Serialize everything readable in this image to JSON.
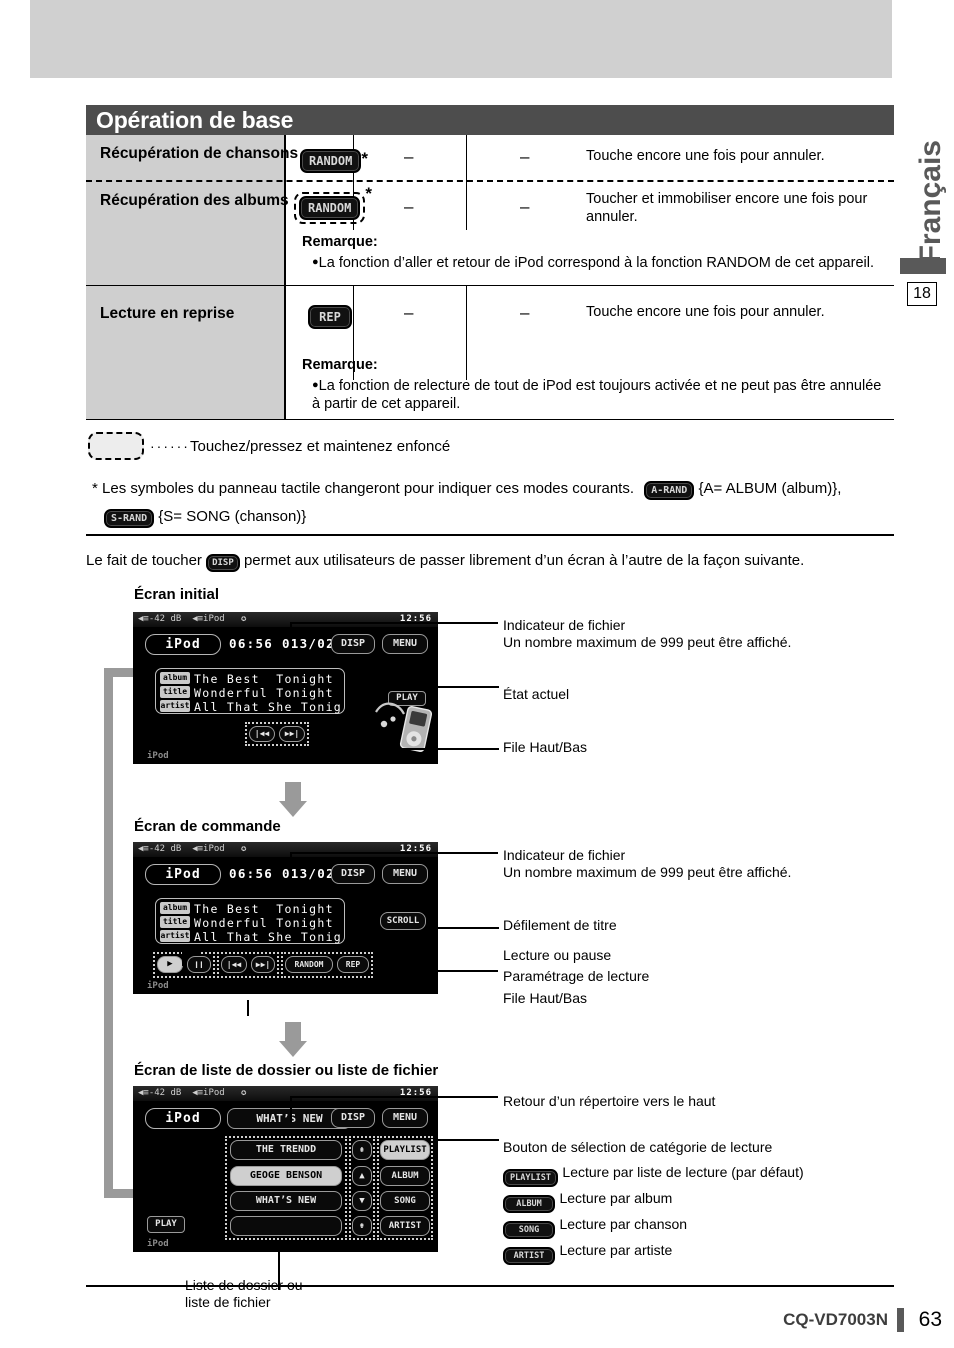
{
  "page": {
    "title": "Opération de base",
    "language_tab": "Français",
    "section_number": "18",
    "model": "CQ-VD7003N",
    "page_number": "63"
  },
  "table": {
    "rows": [
      {
        "label": "Récupération de chansons",
        "key": "RANDOM",
        "key_style": "solid",
        "star": "*",
        "col2": "–",
        "col3": "–",
        "description": "Touche encore une fois pour annuler.",
        "note_title": "",
        "note_body": ""
      },
      {
        "label": "Récupération des albums",
        "key": "RANDOM",
        "key_style": "dashed",
        "star": "*",
        "col2": "–",
        "col3": "–",
        "description": "Toucher et immobiliser encore une fois pour annuler.",
        "note_title": "Remarque:",
        "note_body": "La fonction d’aller et retour de iPod correspond à la fonction RANDOM de cet appareil."
      },
      {
        "label": "Lecture en reprise",
        "key": "REP",
        "key_style": "solid",
        "star": "",
        "col2": "–",
        "col3": "–",
        "description": "Touche encore une fois pour annuler.",
        "note_title": "Remarque:",
        "note_body": "La fonction de relecture de tout de iPod est toujours activée et ne peut pas être annulée à partir de cet appareil."
      }
    ]
  },
  "legend": {
    "dots": "······",
    "text": "Touchez/pressez et maintenez enfoncé"
  },
  "footnote": {
    "star": "*",
    "line1": "Les symboles du panneau tactile changeront pour indiquer ces modes courants.",
    "badge_a": "A-RAND",
    "badge_a_text": "{A= ALBUM (album)},",
    "badge_s": "S-RAND",
    "badge_s_text": "{S= SONG (chanson)}"
  },
  "intro": {
    "before": "Le fait de toucher",
    "badge": "DISP",
    "after": "permet aux utilisateurs de passer librement d’un écran à l’autre de la façon suivante."
  },
  "screens": [
    {
      "section_title": "Écran initial",
      "status_volume": "-42 dB",
      "status_source": "iPod",
      "status_time": "12:56",
      "source_tag": "iPod",
      "track_info": "06:56 013/022",
      "btn_disp": "DISP",
      "btn_menu": "MENU",
      "info": [
        {
          "tag": "album",
          "value": "The Best  Tonight"
        },
        {
          "tag": "title",
          "value": "Wonderful Tonight"
        },
        {
          "tag": "artist",
          "value": "All That She Tonig"
        }
      ],
      "state_badge": "PLAY",
      "transport": [
        "|◀◀",
        "▶▶|"
      ],
      "foot": "iPod",
      "annotations": [
        {
          "text": "Indicateur de fichier\nUn nombre maximum de 999 peut être affiché."
        },
        {
          "text": "État actuel"
        },
        {
          "text": "File Haut/Bas"
        }
      ]
    },
    {
      "section_title": "Écran de commande",
      "status_volume": "-42 dB",
      "status_source": "iPod",
      "status_time": "12:56",
      "source_tag": "iPod",
      "track_info": "06:56 013/022",
      "btn_disp": "DISP",
      "btn_menu": "MENU",
      "info": [
        {
          "tag": "album",
          "value": "The Best  Tonight"
        },
        {
          "tag": "title",
          "value": "Wonderful Tonight"
        },
        {
          "tag": "artist",
          "value": "All That She Tonig"
        }
      ],
      "scroll_badge": "SCROLL",
      "transport": [
        "▶",
        "❙❙",
        "|◀◀",
        "▶▶|"
      ],
      "mode_buttons": [
        "RANDOM",
        "REP"
      ],
      "foot": "iPod",
      "annotations": [
        {
          "text": "Indicateur de fichier\nUn nombre maximum de 999 peut être affiché."
        },
        {
          "text": "Défilement de titre"
        },
        {
          "text": "Lecture ou pause"
        },
        {
          "text": "Paramétrage de lecture"
        },
        {
          "text": "File Haut/Bas"
        }
      ]
    },
    {
      "section_title": "Écran de liste de dossier ou liste de fichier",
      "status_volume": "-42 dB",
      "status_source": "iPod",
      "status_time": "12:56",
      "source_tag": "iPod",
      "header_title": "WHAT’S NEW",
      "btn_disp": "DISP",
      "btn_menu": "MENU",
      "list": [
        "THE TRENDD",
        "GEOGE BENSON",
        "WHAT’S NEW",
        ""
      ],
      "selected_index": 1,
      "scroll_buttons": [
        "⇞",
        "▲",
        "▼",
        "⇟"
      ],
      "category_buttons": [
        "PLAYLIST",
        "ALBUM",
        "SONG",
        "ARTIST"
      ],
      "selected_category": 0,
      "play_badge": "PLAY",
      "foot": "iPod",
      "annotations": [
        {
          "text": "Retour d’un répertoire vers le haut"
        },
        {
          "text": "Bouton de sélection de catégorie de lecture"
        }
      ],
      "category_legend": [
        {
          "badge": "PLAYLIST",
          "text": "Lecture par liste de lecture (par défaut)"
        },
        {
          "badge": "ALBUM",
          "text": "Lecture par album"
        },
        {
          "badge": "SONG",
          "text": "Lecture par chanson"
        },
        {
          "badge": "ARTIST",
          "text": "Lecture par artiste"
        }
      ],
      "bottom_caption": "Liste de dossier ou\nliste de fichier"
    }
  ]
}
